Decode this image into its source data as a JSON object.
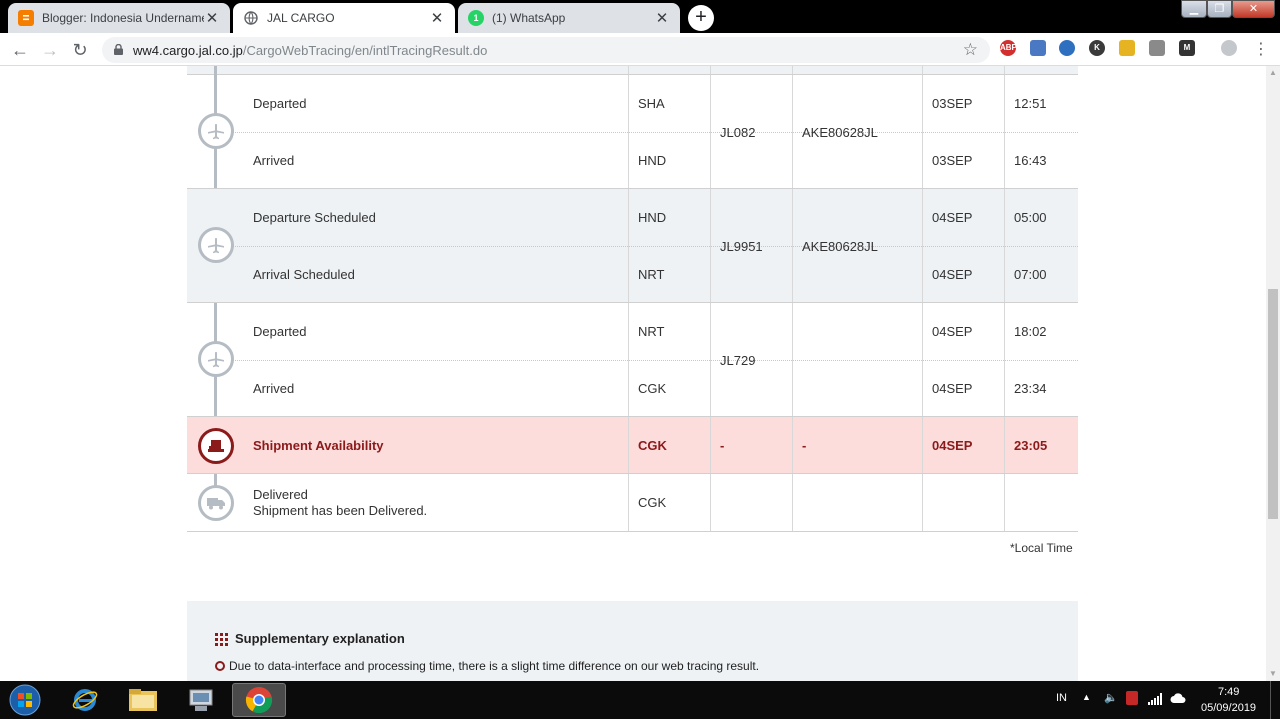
{
  "tabs": [
    {
      "title": "Blogger: Indonesia Undername D",
      "icon": "blogger-icon",
      "active": false
    },
    {
      "title": "JAL CARGO",
      "icon": "globe-icon",
      "active": true
    },
    {
      "title": "(1) WhatsApp",
      "icon": "whatsapp-icon",
      "active": false
    }
  ],
  "new_tab_label": "+",
  "address": {
    "host": "ww4.cargo.jal.co.jp",
    "path": "/CargoWebTracing/en/intlTracingResult.do"
  },
  "extensions": [
    "abp",
    "ext2",
    "ext3",
    "ext4",
    "ext5",
    "ext6",
    "ext7"
  ],
  "flight_groups": [
    {
      "flight": "JL082",
      "uld": "AKE80628JL",
      "icon": "airplane-icon",
      "rows": [
        {
          "status": "Departed",
          "station": "SHA",
          "date": "03SEP",
          "time": "12:51"
        },
        {
          "status": "Arrived",
          "station": "HND",
          "date": "03SEP",
          "time": "16:43"
        }
      ]
    },
    {
      "flight": "JL9951",
      "uld": "AKE80628JL",
      "icon": "airplane-icon",
      "rows": [
        {
          "status": "Departure Scheduled",
          "station": "HND",
          "date": "04SEP",
          "time": "05:00"
        },
        {
          "status": "Arrival Scheduled",
          "station": "NRT",
          "date": "04SEP",
          "time": "07:00"
        }
      ]
    },
    {
      "flight": "JL729",
      "uld": "",
      "icon": "airplane-icon",
      "rows": [
        {
          "status": "Departed",
          "station": "NRT",
          "date": "04SEP",
          "time": "18:02"
        },
        {
          "status": "Arrived",
          "station": "CGK",
          "date": "04SEP",
          "time": "23:34"
        }
      ]
    }
  ],
  "availability": {
    "status": "Shipment Availability",
    "station": "CGK",
    "flight": "-",
    "uld": "-",
    "date": "04SEP",
    "time": "23:05",
    "icon": "shipment-icon"
  },
  "delivered": {
    "status": "Delivered",
    "detail": "Shipment has been Delivered.",
    "station": "CGK",
    "icon": "truck-icon"
  },
  "local_time_note": "*Local Time",
  "supplementary": {
    "title": "Supplementary explanation",
    "text": "Due to data-interface and processing time, there is a slight time difference on our web tracing result."
  },
  "taskbar": {
    "language": "IN",
    "time": "7:49",
    "date": "05/09/2019"
  },
  "colors": {
    "highlight_bg": "#fddcdc",
    "highlight_text": "#8b1a1a",
    "shade_bg": "#eef2f5"
  }
}
